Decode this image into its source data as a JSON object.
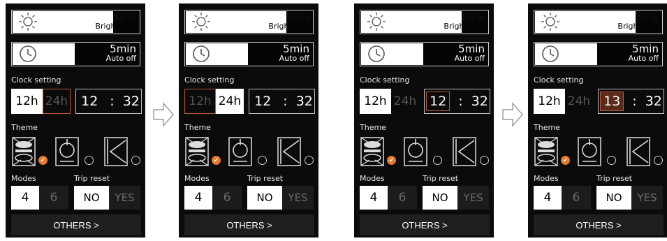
{
  "brightness": {
    "value_label": "80%",
    "sub_label": "Brightness",
    "level": 0.8
  },
  "auto_off": {
    "value_label": "5min",
    "sub_label": "Auto off",
    "level": 0.5
  },
  "clock": {
    "section_label": "Clock setting",
    "btn_12": "12h",
    "btn_24": "24h",
    "separator": ":",
    "minute": "32"
  },
  "theme": {
    "section_label": "Theme",
    "check_glyph": "✔"
  },
  "modes": {
    "section_label": "Modes",
    "opt_a": "4",
    "opt_b": "6"
  },
  "trip": {
    "section_label": "Trip reset",
    "no": "NO",
    "yes": "YES"
  },
  "others": {
    "label": "OTHERS >"
  },
  "panels": [
    {
      "hour": "12",
      "format": "12h",
      "focus": "24h"
    },
    {
      "hour": "12",
      "format": "24h",
      "focus": "12h"
    },
    {
      "hour": "12",
      "format": "12h",
      "focus": "hour"
    },
    {
      "hour": "13",
      "format": "12h",
      "focus": "hour-edit"
    }
  ],
  "colors": {
    "accent": "#b8573a",
    "check": "#e8782d",
    "panel_bg": "#0b0b0b"
  }
}
